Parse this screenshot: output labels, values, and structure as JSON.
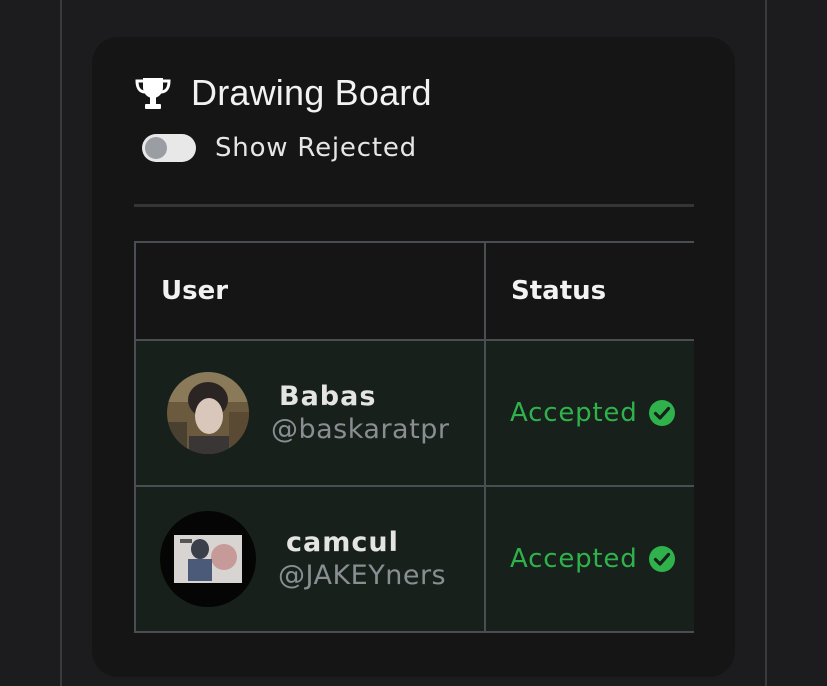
{
  "card": {
    "title": "Drawing Board",
    "title_icon": "trophy-icon",
    "toggle": {
      "label": "Show Rejected",
      "state": "off"
    }
  },
  "table": {
    "columns": [
      "User",
      "Status"
    ],
    "rows": [
      {
        "name": "Babas",
        "handle": "@baskaratpr",
        "status": "Accepted",
        "status_icon": "check-circle-icon"
      },
      {
        "name": "camcul",
        "handle": "@JAKEYners",
        "status": "Accepted",
        "status_icon": "check-circle-icon"
      }
    ]
  },
  "colors": {
    "background": "#1c1c1e",
    "card": "#151515",
    "accepted": "#2fb24c",
    "row_bg": "#17201a",
    "border": "#4a4d52"
  }
}
